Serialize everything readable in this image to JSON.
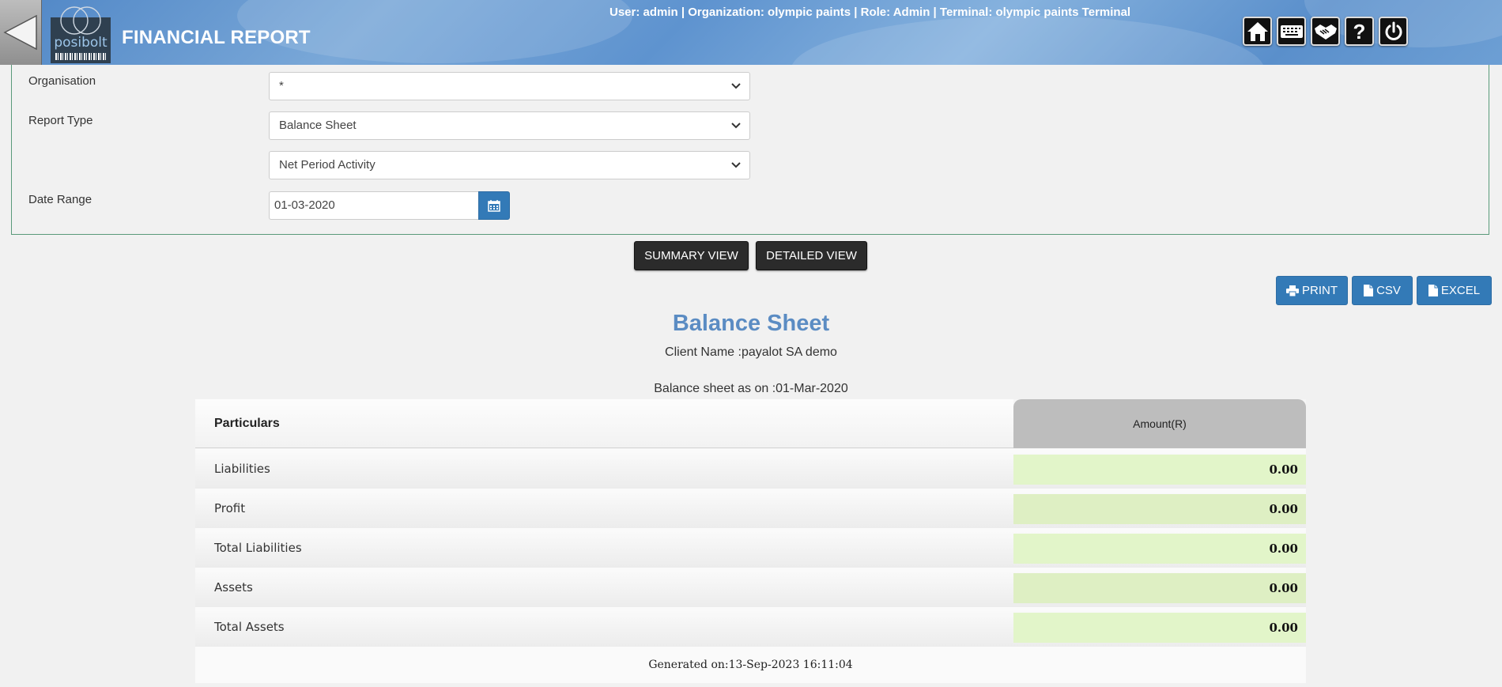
{
  "header": {
    "title": "FINANCIAL REPORT",
    "logo_text": "posibolt",
    "user_info": "User: admin | Organization: olympic paints | Role: Admin | Terminal: olympic paints Terminal",
    "icons": [
      "home-icon",
      "keyboard-icon",
      "handshake-icon",
      "help-icon",
      "power-icon"
    ],
    "help_glyph": "?"
  },
  "filters": {
    "organisation_label": "Organisation",
    "organisation_value": "*",
    "report_type_label": "Report Type",
    "report_type_value": "Balance Sheet",
    "activity_value": "Net Period Activity",
    "date_range_label": "Date Range",
    "date_value": "01-03-2020"
  },
  "views": {
    "summary_label": "SUMMARY VIEW",
    "detailed_label": "DETAILED VIEW"
  },
  "export": {
    "print_label": "PRINT",
    "csv_label": "CSV",
    "excel_label": "EXCEL"
  },
  "report": {
    "title": "Balance Sheet",
    "client": "Client Name :payalot SA demo",
    "as_of": "Balance sheet as on :01-Mar-2020",
    "col_particulars": "Particulars",
    "col_amount": "Amount(R)",
    "rows": [
      {
        "label": "Liabilities",
        "amount": "0.00"
      },
      {
        "label": "Profit",
        "amount": "0.00"
      },
      {
        "label": "Total Liabilities",
        "amount": "0.00"
      },
      {
        "label": "Assets",
        "amount": "0.00"
      },
      {
        "label": "Total Assets",
        "amount": "0.00"
      }
    ],
    "generated": "Generated on:13-Sep-2023 16:11:04"
  },
  "colors": {
    "accent": "#337ab7",
    "title_blue": "#5b8cc3",
    "amount_cell": "#e2f5c9"
  }
}
